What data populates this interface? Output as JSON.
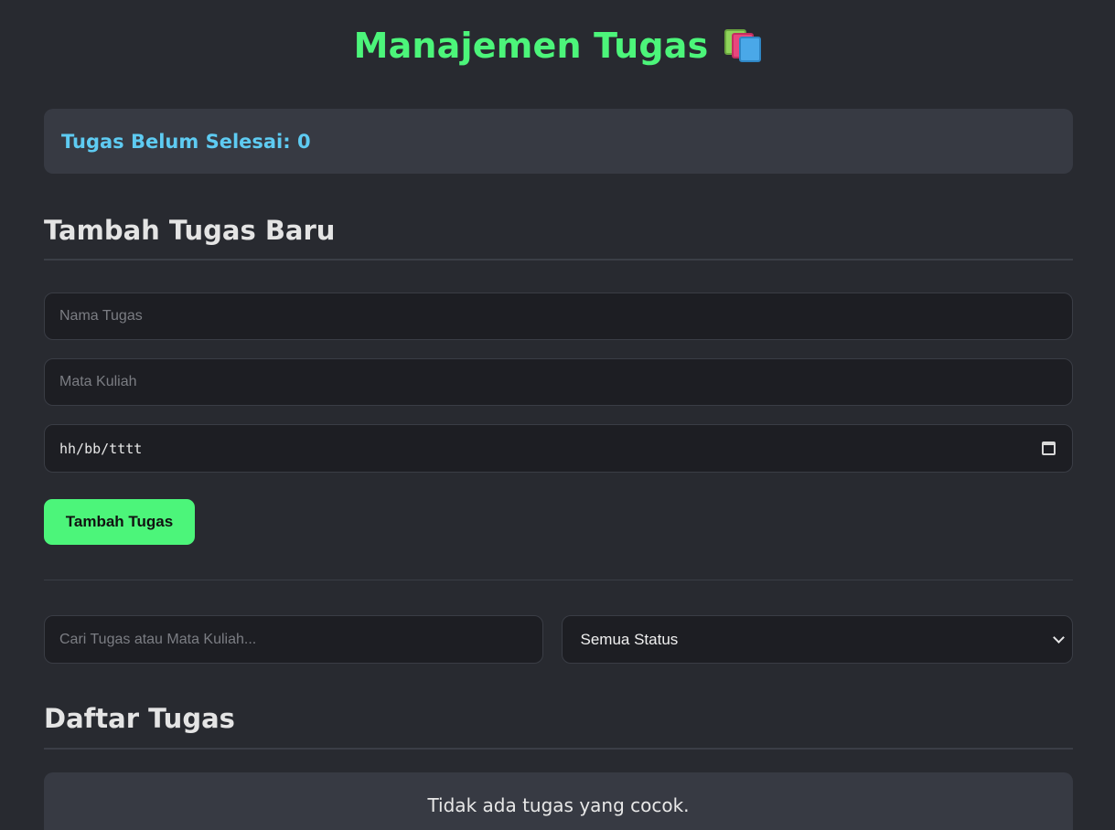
{
  "header": {
    "title": "Manajemen Tugas",
    "icon": "books-icon"
  },
  "summary": {
    "pending_label": "Tugas Belum Selesai: 0"
  },
  "add_section": {
    "title": "Tambah Tugas Baru",
    "task_name_placeholder": "Nama Tugas",
    "course_placeholder": "Mata Kuliah",
    "date_placeholder": "hh/bb/tttt",
    "submit_label": "Tambah Tugas"
  },
  "filters": {
    "search_placeholder": "Cari Tugas atau Mata Kuliah...",
    "status_selected": "Semua Status"
  },
  "list_section": {
    "title": "Daftar Tugas",
    "empty_message": "Tidak ada tugas yang cocok."
  },
  "colors": {
    "accent": "#4cf57a",
    "info": "#5ecbf2",
    "background": "#282a30",
    "card": "#373a43"
  }
}
